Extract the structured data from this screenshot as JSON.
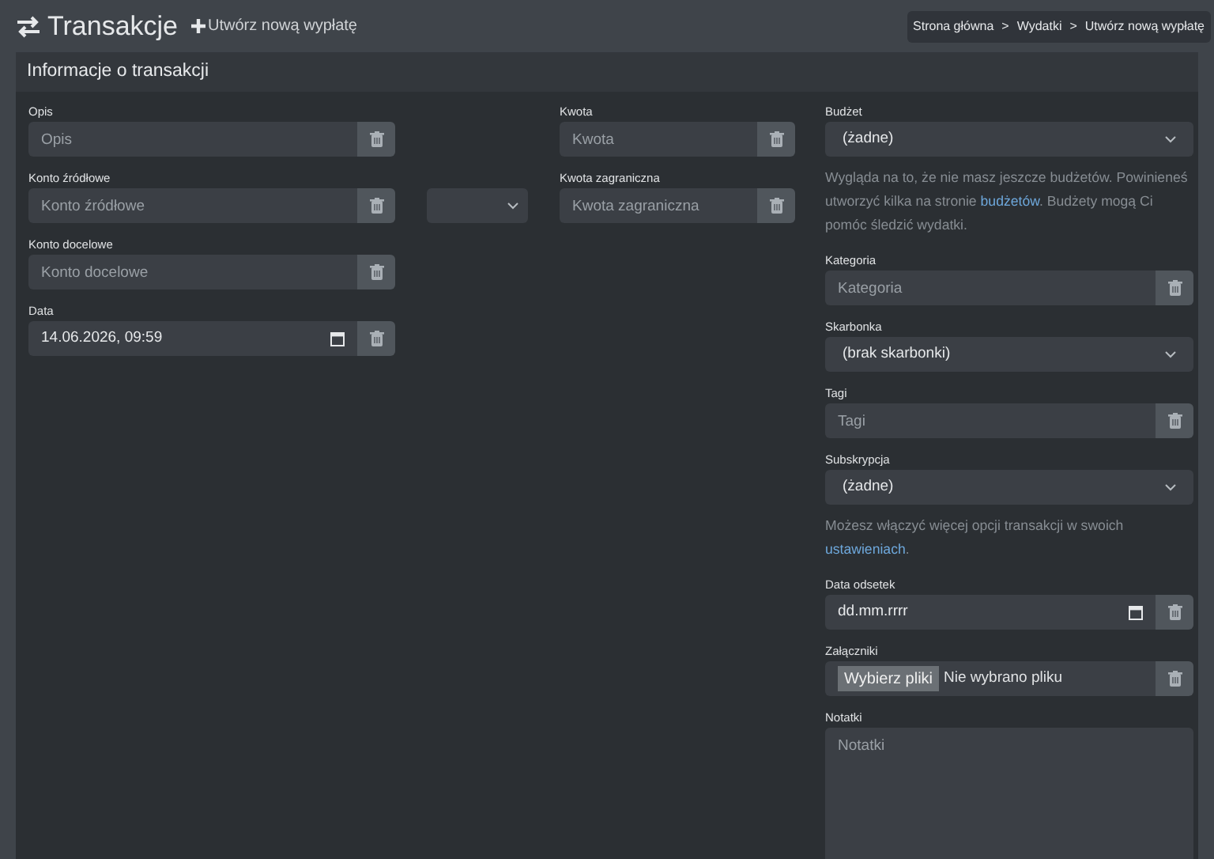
{
  "header": {
    "title": "Transakcje",
    "action": "Utwórz nową wypłatę"
  },
  "breadcrumbs": {
    "separator": ">",
    "items": [
      "Strona główna",
      "Wydatki",
      "Utwórz nową wypłatę"
    ]
  },
  "panel": {
    "title": "Informacje o transakcji"
  },
  "columns": [
    [
      {
        "kind": "text",
        "label": "Opis",
        "placeholder": "Opis"
      },
      {
        "kind": "text_currency",
        "label": "Konto źródłowe",
        "placeholder": "Konto źródłowe"
      },
      {
        "kind": "text",
        "label": "Konto docelowe",
        "placeholder": "Konto docelowe"
      },
      {
        "kind": "date",
        "label": "Data",
        "value": "14.06.2026, 09:59"
      }
    ],
    [
      {
        "kind": "text",
        "label": "Kwota",
        "placeholder": "Kwota"
      },
      {
        "kind": "text",
        "label": "Kwota zagraniczna",
        "placeholder": "Kwota zagraniczna"
      }
    ],
    [
      {
        "kind": "select",
        "label": "Budżet",
        "value": "(żadne)"
      },
      {
        "kind": "help",
        "parts": [
          {
            "kind": "text",
            "text": "Wygląda na to, że nie masz jeszcze budżetów. Powinieneś utworzyć kilka na stronie "
          },
          {
            "kind": "link",
            "text": "budżetów"
          },
          {
            "kind": "text",
            "text": ". Budżety mogą Ci pomóc śledzić wydatki."
          }
        ]
      },
      {
        "kind": "text",
        "label": "Kategoria",
        "placeholder": "Kategoria"
      },
      {
        "kind": "select",
        "label": "Skarbonka",
        "value": "(brak skarbonki)"
      },
      {
        "kind": "text",
        "label": "Tagi",
        "placeholder": "Tagi"
      },
      {
        "kind": "select",
        "label": "Subskrypcja",
        "value": "(żadne)"
      },
      {
        "kind": "help",
        "parts": [
          {
            "kind": "text",
            "text": "Możesz włączyć więcej opcji transakcji w swoich "
          },
          {
            "kind": "link",
            "text": "ustawieniach"
          },
          {
            "kind": "text",
            "text": "."
          }
        ]
      },
      {
        "kind": "date",
        "label": "Data odsetek",
        "value": "dd.mm.rrrr"
      },
      {
        "kind": "file",
        "label": "Załączniki",
        "button": "Wybierz pliki",
        "value": "Nie wybrano pliku"
      },
      {
        "kind": "textarea",
        "label": "Notatki",
        "placeholder": "Notatki"
      }
    ]
  ]
}
